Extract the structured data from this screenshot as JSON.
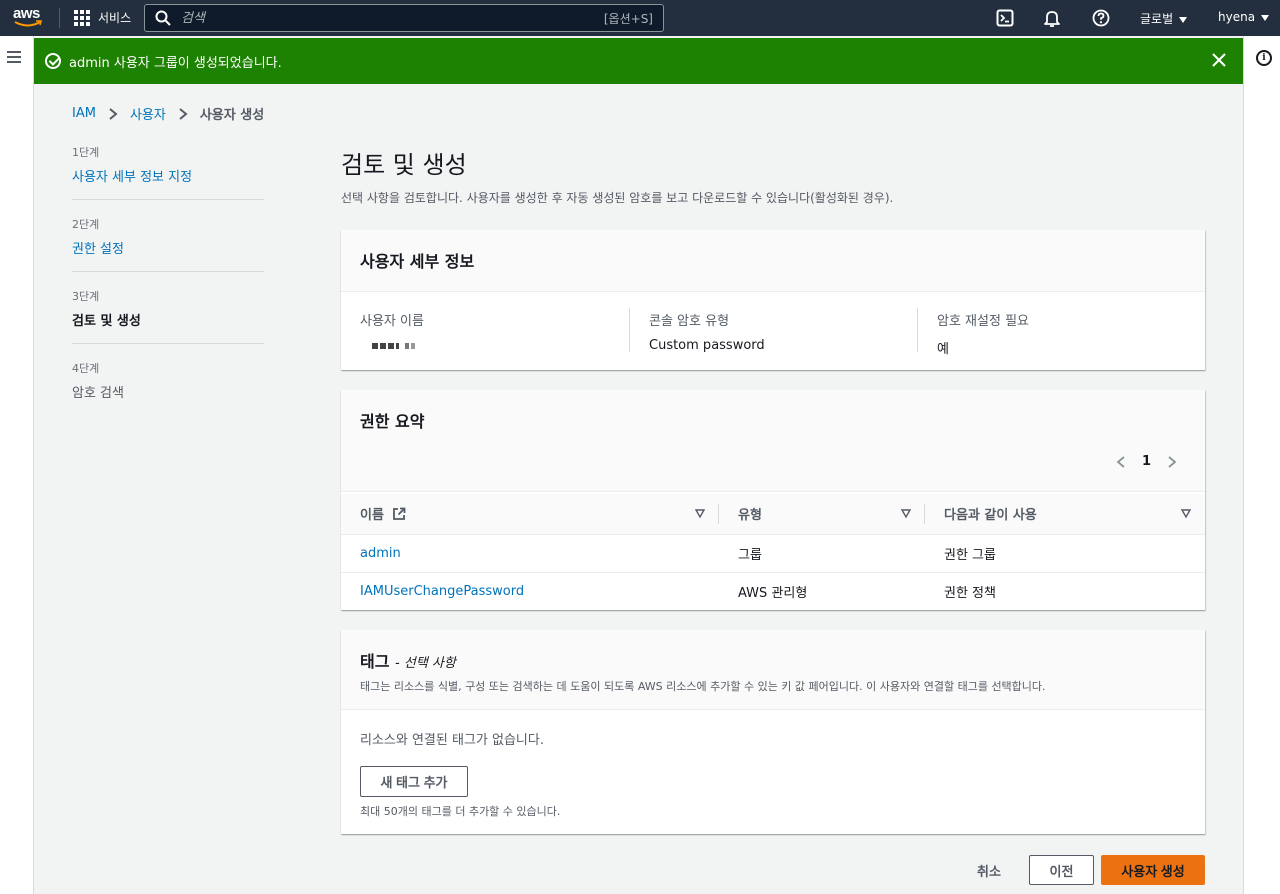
{
  "topnav": {
    "logo_text": "aws",
    "services_label": "서비스",
    "search_placeholder": "검색",
    "search_shortcut": "[옵션+S]",
    "region_label": "글로벌",
    "user_label": "hyena"
  },
  "flash": {
    "message": "admin 사용자 그룹이 생성되었습니다.",
    "color": "#1d8102"
  },
  "breadcrumb": {
    "items": [
      "IAM",
      "사용자"
    ],
    "current": "사용자 생성"
  },
  "steps": [
    {
      "num": "1단계",
      "name": "사용자 세부 정보 지정"
    },
    {
      "num": "2단계",
      "name": "권한 설정"
    },
    {
      "num": "3단계",
      "name": "검토 및 생성"
    },
    {
      "num": "4단계",
      "name": "암호 검색"
    }
  ],
  "page": {
    "title": "검토 및 생성",
    "subtitle": "선택 사항을 검토합니다. 사용자를 생성한 후 자동 생성된 암호를 보고 다운로드할 수 있습니다(활성화된 경우)."
  },
  "user_details": {
    "title": "사용자 세부 정보",
    "username_label": "사용자 이름",
    "console_pw_label": "콘솔 암호 유형",
    "console_pw_value": "Custom password",
    "reset_label": "암호 재설정 필요",
    "reset_value": "예"
  },
  "permissions": {
    "title": "권한 요약",
    "page": "1",
    "columns": [
      "이름",
      "유형",
      "다음과 같이 사용"
    ],
    "rows": [
      {
        "name": "admin",
        "type": "그룹",
        "used_as": "권한 그룹"
      },
      {
        "name": "IAMUserChangePassword",
        "type": "AWS 관리형",
        "used_as": "권한 정책"
      }
    ]
  },
  "tags": {
    "title": "태그",
    "optional": "- 선택 사항",
    "description": "태그는 리소스를 식별, 구성 또는 검색하는 데 도움이 되도록 AWS 리소스에 추가할 수 있는 키 값 페어입니다. 이 사용자와 연결할 태그를 선택합니다.",
    "empty": "리소스와 연결된 태그가 없습니다.",
    "add_button": "새 태그 추가",
    "hint": "최대 50개의 태그를 더 추가할 수 있습니다."
  },
  "actions": {
    "cancel": "취소",
    "previous": "이전",
    "create": "사용자 생성",
    "primary_color": "#ec7211"
  }
}
